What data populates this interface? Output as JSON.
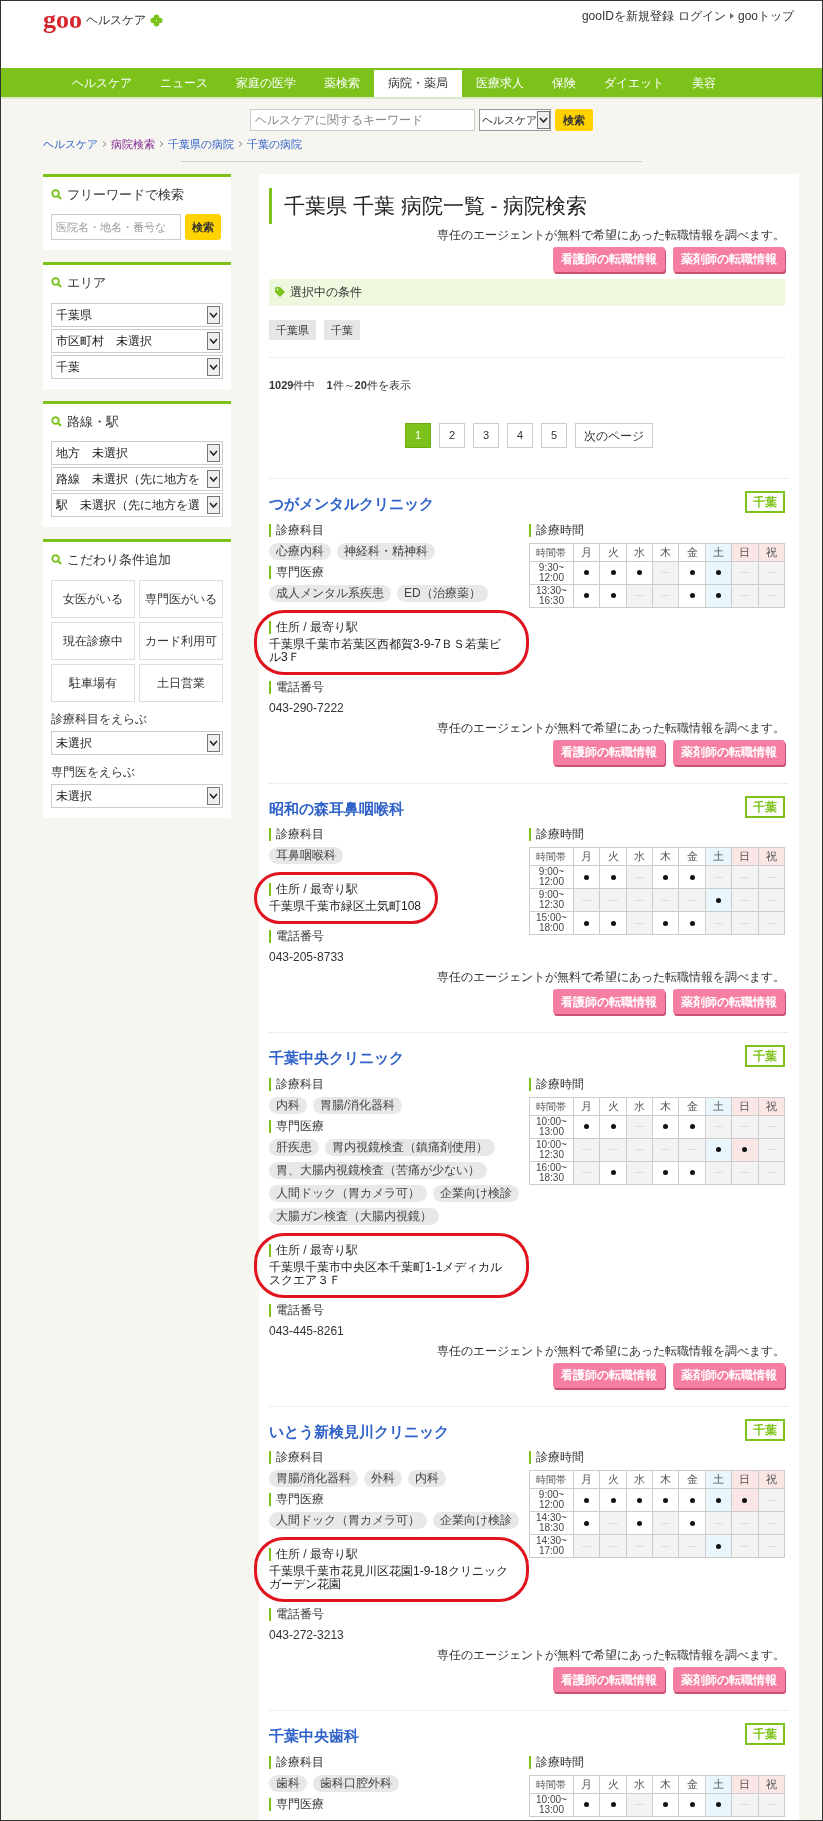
{
  "header": {
    "logo": "goo",
    "site": "ヘルスケア",
    "links": [
      "gooIDを新規登録",
      "ログイン",
      "gooトップ"
    ]
  },
  "nav": [
    {
      "label": "ヘルスケア",
      "selected": false
    },
    {
      "label": "ニュース",
      "selected": false
    },
    {
      "label": "家庭の医学",
      "selected": false
    },
    {
      "label": "薬検索",
      "selected": false
    },
    {
      "label": "病院・薬局",
      "selected": true
    },
    {
      "label": "医療求人",
      "selected": false
    },
    {
      "label": "保険",
      "selected": false
    },
    {
      "label": "ダイエット",
      "selected": false
    },
    {
      "label": "美容",
      "selected": false
    }
  ],
  "search": {
    "placeholder": "ヘルスケアに関するキーワード",
    "scope": "ヘルスケア",
    "button": "検索"
  },
  "breadcrumbs": [
    {
      "label": "ヘルスケア",
      "visited": false
    },
    {
      "label": "病院検索",
      "visited": true
    },
    {
      "label": "千葉県の病院",
      "visited": false
    },
    {
      "label": "千葉の病院",
      "visited": false
    }
  ],
  "sidebar": [
    {
      "kind": "search",
      "title": "フリーワードで検索",
      "placeholder": "医院名・地名・番号な",
      "button": "検索"
    },
    {
      "kind": "selects",
      "title": "エリア",
      "selects": [
        "千葉県",
        "市区町村　未選択",
        "千葉"
      ]
    },
    {
      "kind": "selects",
      "title": "路線・駅",
      "selects": [
        "地方　未選択",
        "路線　未選択（先に地方を",
        "駅　未選択（先に地方を選"
      ]
    },
    {
      "kind": "filters",
      "title": "こだわり条件追加",
      "filters": [
        "女医がいる",
        "専門医がいる",
        "現在診療中",
        "カード利用可",
        "駐車場有",
        "土日営業"
      ],
      "dropdowns": [
        {
          "label": "診療科目をえらぶ",
          "value": "未選択"
        },
        {
          "label": "専門医をえらぶ",
          "value": "未選択"
        }
      ]
    }
  ],
  "main": {
    "title": "千葉県 千葉 病院一覧 - 病院検索",
    "job_ad": {
      "note": "専任のエージェントが無料で希望にあった転職情報を調べます。",
      "buttons": [
        "看護師の転職情報",
        "薬剤師の転職情報"
      ]
    },
    "conditions": {
      "title": "選択中の条件",
      "chips": [
        "千葉県",
        "千葉"
      ]
    },
    "count": "**1029**件中　**1**件～**20**件を表示",
    "pages": [
      {
        "label": "1",
        "selected": true
      },
      {
        "label": "2",
        "selected": false
      },
      {
        "label": "3",
        "selected": false
      },
      {
        "label": "4",
        "selected": false
      },
      {
        "label": "5",
        "selected": false
      }
    ],
    "next": "次のページ",
    "clinics": [
      {
        "name": "つがメンタルクリニック",
        "area": "千葉",
        "subjects_label": "診療科目",
        "subjects": [
          "心療内科",
          "神経科・精神科"
        ],
        "specialties_label": "専門医療",
        "specialties": [
          "成人メンタル系疾患",
          "ED（治療薬）"
        ],
        "address_label": "住所 / 最寄り駅",
        "address": "千葉県千葉市若葉区西都賀3-9-7ＢＳ若葉ビル3Ｆ",
        "highlighted": true,
        "phone_label": "電話番号",
        "phone": "043-290-7222",
        "hours_label": "診療時間",
        "schedule": {
          "time_header": "時間帯",
          "days": [
            {
              "label": "月",
              "kind": "weekday"
            },
            {
              "label": "火",
              "kind": "weekday"
            },
            {
              "label": "水",
              "kind": "weekday"
            },
            {
              "label": "木",
              "kind": "weekday"
            },
            {
              "label": "金",
              "kind": "weekday"
            },
            {
              "label": "土",
              "kind": "saturday"
            },
            {
              "label": "日",
              "kind": "holiday"
            },
            {
              "label": "祝",
              "kind": "holiday"
            }
          ],
          "rows": [
            {
              "from": "9:30~",
              "to": "12:00",
              "open": [
                true,
                true,
                true,
                false,
                true,
                true,
                false,
                false
              ]
            },
            {
              "from": "13:30~",
              "to": "16:30",
              "open": [
                true,
                true,
                false,
                false,
                true,
                true,
                false,
                false
              ]
            }
          ]
        },
        "job_ad": {
          "note": "専任のエージェントが無料で希望にあった転職情報を調べます。",
          "buttons": [
            "看護師の転職情報",
            "薬剤師の転職情報"
          ]
        }
      },
      {
        "name": "昭和の森耳鼻咽喉科",
        "area": "千葉",
        "subjects_label": "診療科目",
        "subjects": [
          "耳鼻咽喉科"
        ],
        "address_label": "住所 / 最寄り駅",
        "address": "千葉県千葉市緑区土気町108",
        "highlighted": true,
        "phone_label": "電話番号",
        "phone": "043-205-8733",
        "hours_label": "診療時間",
        "schedule": {
          "time_header": "時間帯",
          "days": [
            {
              "label": "月",
              "kind": "weekday"
            },
            {
              "label": "火",
              "kind": "weekday"
            },
            {
              "label": "水",
              "kind": "weekday"
            },
            {
              "label": "木",
              "kind": "weekday"
            },
            {
              "label": "金",
              "kind": "weekday"
            },
            {
              "label": "土",
              "kind": "saturday"
            },
            {
              "label": "日",
              "kind": "holiday"
            },
            {
              "label": "祝",
              "kind": "holiday"
            }
          ],
          "rows": [
            {
              "from": "9:00~",
              "to": "12:00",
              "open": [
                true,
                true,
                false,
                true,
                true,
                false,
                false,
                false
              ]
            },
            {
              "from": "9:00~",
              "to": "12:30",
              "open": [
                false,
                false,
                false,
                false,
                false,
                true,
                false,
                false
              ]
            },
            {
              "from": "15:00~",
              "to": "18:00",
              "open": [
                true,
                true,
                false,
                true,
                true,
                false,
                false,
                false
              ]
            }
          ]
        },
        "job_ad": {
          "note": "専任のエージェントが無料で希望にあった転職情報を調べます。",
          "buttons": [
            "看護師の転職情報",
            "薬剤師の転職情報"
          ]
        }
      },
      {
        "name": "千葉中央クリニック",
        "area": "千葉",
        "subjects_label": "診療科目",
        "subjects": [
          "内科",
          "胃腸/消化器科"
        ],
        "specialties_label": "専門医療",
        "specialties": [
          "肝疾患",
          "胃内視鏡検査（鎮痛剤使用）",
          "胃、大腸内視鏡検査（苦痛が少ない）",
          "人間ドック（胃カメラ可）",
          "企業向け検診",
          "大腸ガン検査（大腸内視鏡）"
        ],
        "address_label": "住所 / 最寄り駅",
        "address": "千葉県千葉市中央区本千葉町1-1メディカルスクエア３Ｆ",
        "highlighted": true,
        "phone_label": "電話番号",
        "phone": "043-445-8261",
        "hours_label": "診療時間",
        "schedule": {
          "time_header": "時間帯",
          "days": [
            {
              "label": "月",
              "kind": "weekday"
            },
            {
              "label": "火",
              "kind": "weekday"
            },
            {
              "label": "水",
              "kind": "weekday"
            },
            {
              "label": "木",
              "kind": "weekday"
            },
            {
              "label": "金",
              "kind": "weekday"
            },
            {
              "label": "土",
              "kind": "saturday"
            },
            {
              "label": "日",
              "kind": "holiday"
            },
            {
              "label": "祝",
              "kind": "holiday"
            }
          ],
          "rows": [
            {
              "from": "10:00~",
              "to": "13:00",
              "open": [
                true,
                true,
                false,
                true,
                true,
                false,
                false,
                false
              ]
            },
            {
              "from": "10:00~",
              "to": "12:30",
              "open": [
                false,
                false,
                false,
                false,
                false,
                true,
                true,
                false
              ]
            },
            {
              "from": "16:00~",
              "to": "18:30",
              "open": [
                false,
                true,
                false,
                true,
                true,
                false,
                false,
                false
              ]
            }
          ]
        },
        "job_ad": {
          "note": "専任のエージェントが無料で希望にあった転職情報を調べます。",
          "buttons": [
            "看護師の転職情報",
            "薬剤師の転職情報"
          ]
        }
      },
      {
        "name": "いとう新検見川クリニック",
        "area": "千葉",
        "subjects_label": "診療科目",
        "subjects": [
          "胃腸/消化器科",
          "外科",
          "内科"
        ],
        "specialties_label": "専門医療",
        "specialties": [
          "人間ドック（胃カメラ可）",
          "企業向け検診"
        ],
        "address_label": "住所 / 最寄り駅",
        "address": "千葉県千葉市花見川区花園1-9-18クリニックガーデン花園",
        "highlighted": true,
        "phone_label": "電話番号",
        "phone": "043-272-3213",
        "hours_label": "診療時間",
        "schedule": {
          "time_header": "時間帯",
          "days": [
            {
              "label": "月",
              "kind": "weekday"
            },
            {
              "label": "火",
              "kind": "weekday"
            },
            {
              "label": "水",
              "kind": "weekday"
            },
            {
              "label": "木",
              "kind": "weekday"
            },
            {
              "label": "金",
              "kind": "weekday"
            },
            {
              "label": "土",
              "kind": "saturday"
            },
            {
              "label": "日",
              "kind": "holiday"
            },
            {
              "label": "祝",
              "kind": "holiday"
            }
          ],
          "rows": [
            {
              "from": "9:00~",
              "to": "12:00",
              "open": [
                true,
                true,
                true,
                true,
                true,
                true,
                true,
                false
              ]
            },
            {
              "from": "14:30~",
              "to": "18:30",
              "open": [
                true,
                false,
                true,
                false,
                true,
                false,
                false,
                false
              ]
            },
            {
              "from": "14:30~",
              "to": "17:00",
              "open": [
                false,
                false,
                false,
                false,
                false,
                true,
                false,
                false
              ]
            }
          ]
        },
        "job_ad": {
          "note": "専任のエージェントが無料で希望にあった転職情報を調べます。",
          "buttons": [
            "看護師の転職情報",
            "薬剤師の転職情報"
          ]
        }
      },
      {
        "name": "千葉中央歯科",
        "area": "千葉",
        "subjects_label": "診療科目",
        "subjects": [
          "歯科",
          "歯科口腔外科"
        ],
        "specialties_label": "専門医療",
        "hours_label": "診療時間",
        "schedule": {
          "time_header": "時間帯",
          "days": [
            {
              "label": "月",
              "kind": "weekday"
            },
            {
              "label": "火",
              "kind": "weekday"
            },
            {
              "label": "水",
              "kind": "weekday"
            },
            {
              "label": "木",
              "kind": "weekday"
            },
            {
              "label": "金",
              "kind": "weekday"
            },
            {
              "label": "土",
              "kind": "saturday"
            },
            {
              "label": "日",
              "kind": "holiday"
            },
            {
              "label": "祝",
              "kind": "holiday"
            }
          ],
          "rows": [
            {
              "from": "10:00~",
              "to": "13:00",
              "open": [
                true,
                true,
                false,
                true,
                true,
                true,
                false,
                false
              ]
            }
          ]
        }
      }
    ]
  }
}
